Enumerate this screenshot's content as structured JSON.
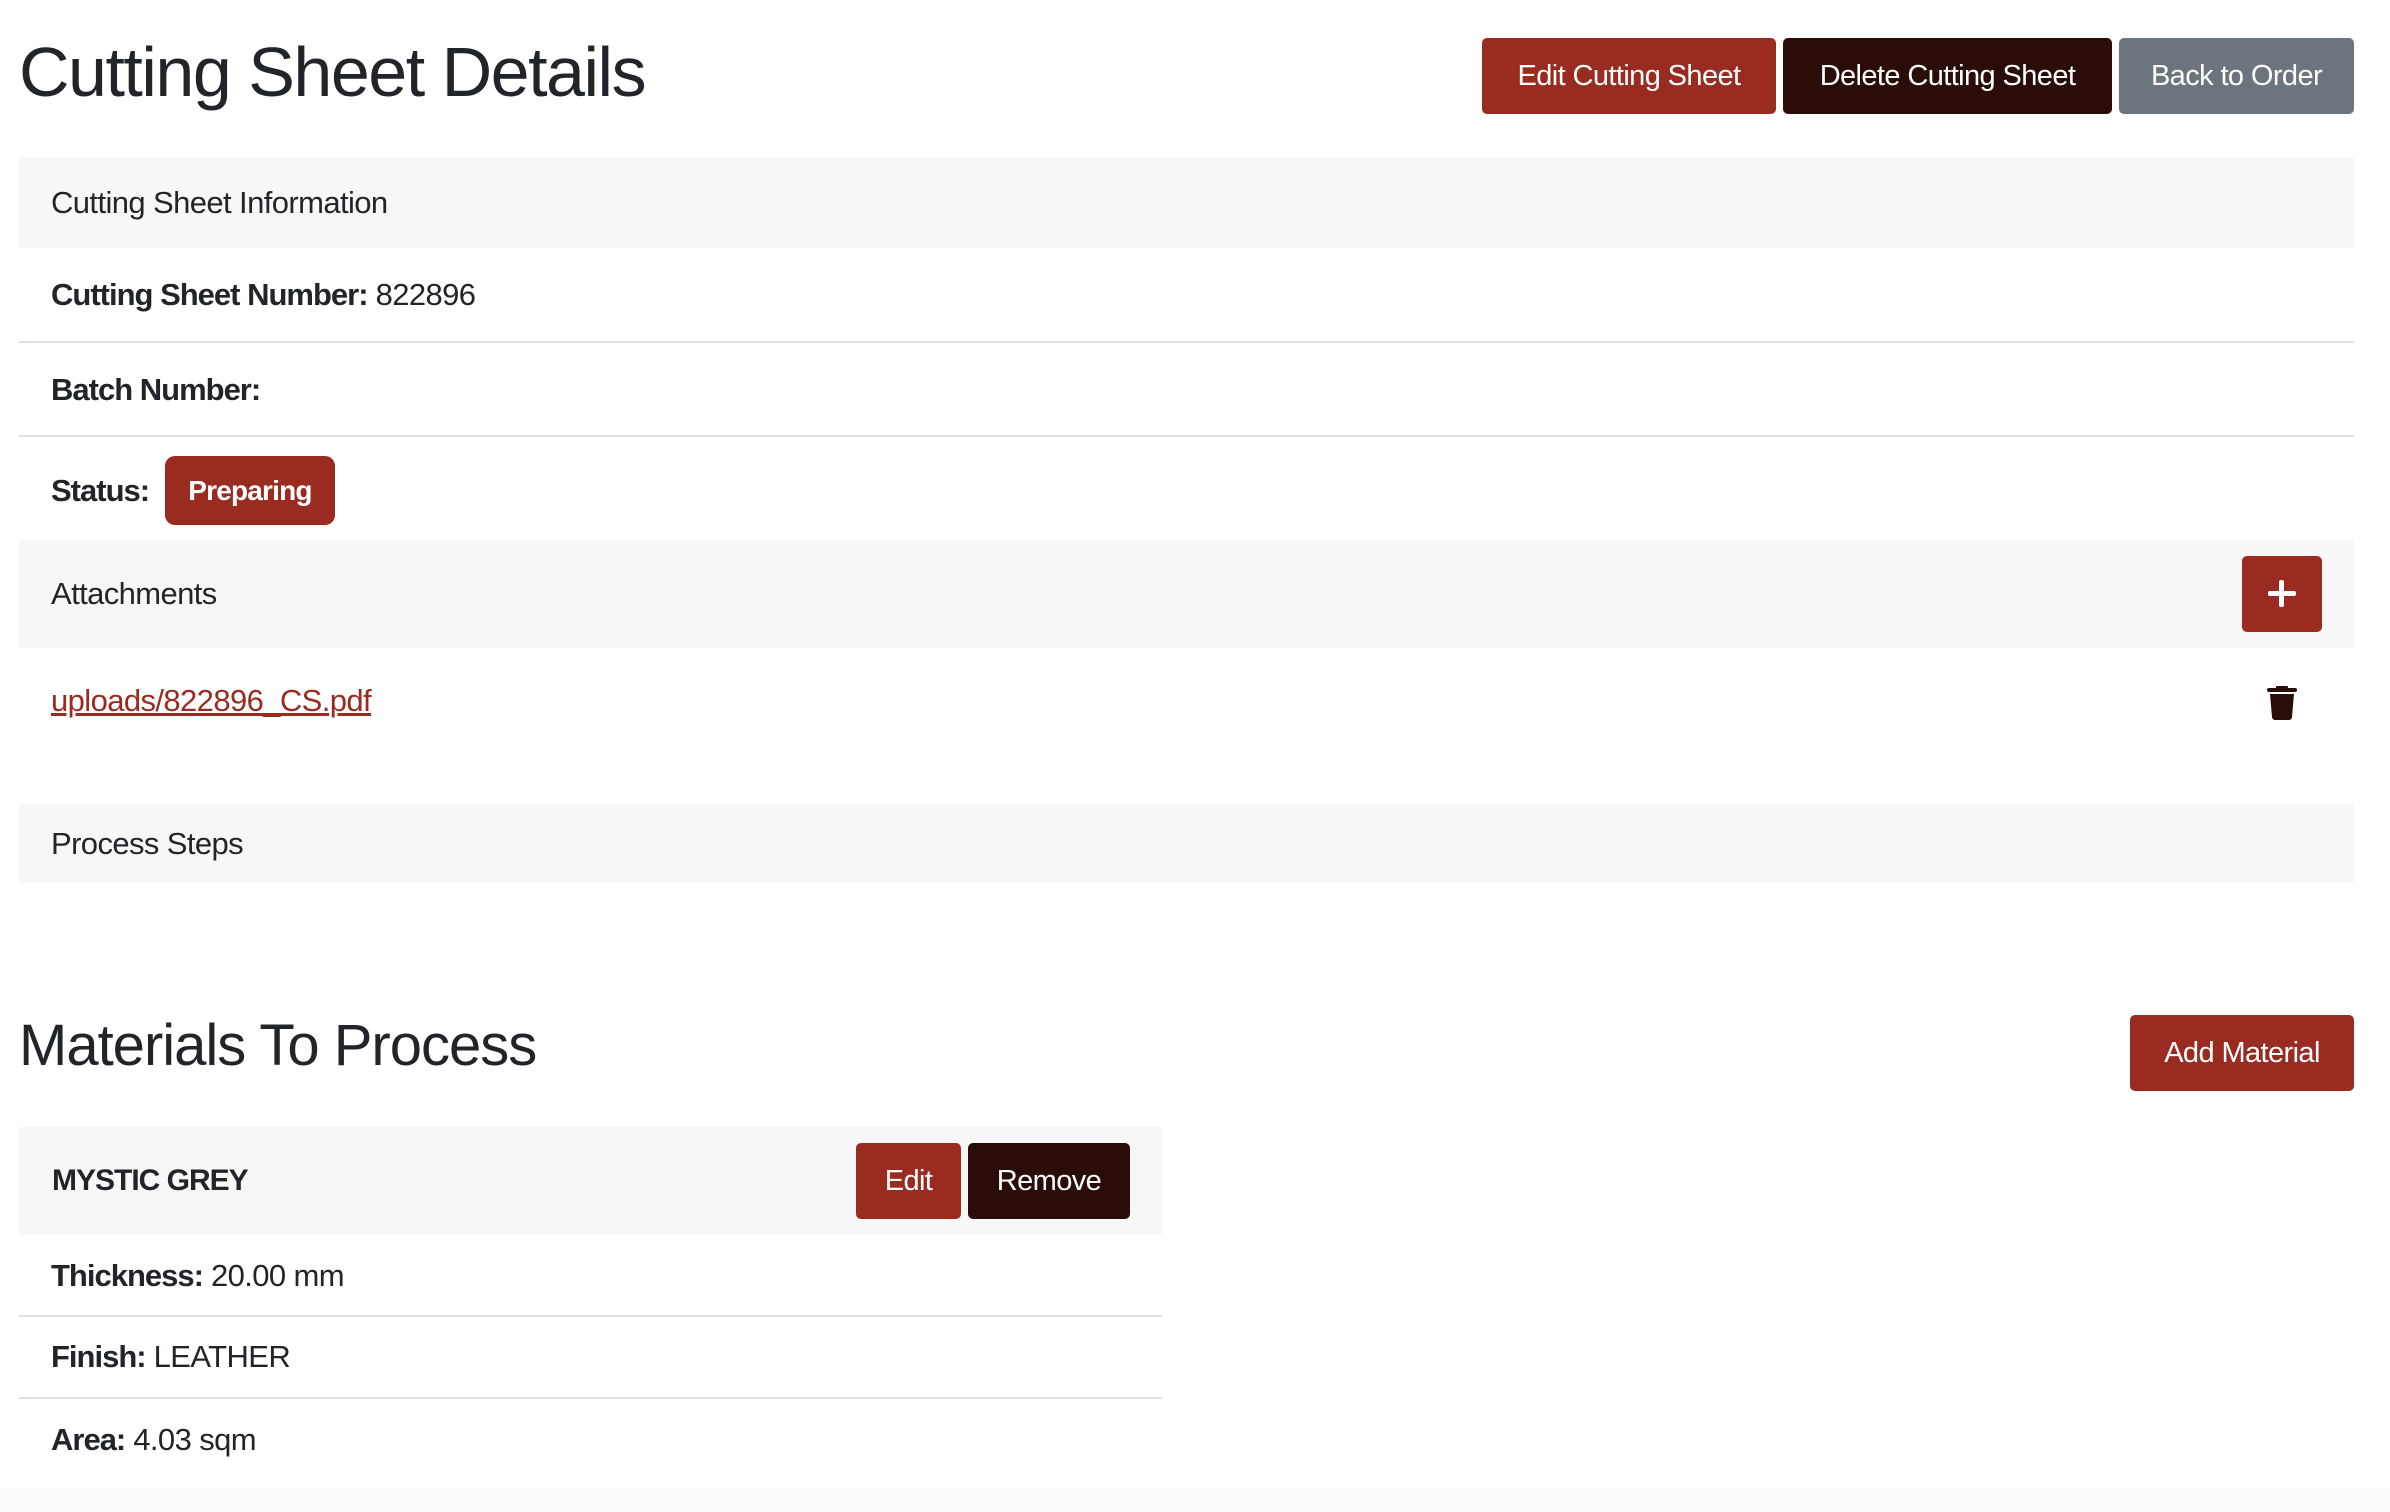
{
  "header": {
    "title": "Cutting Sheet Details",
    "buttons": {
      "edit": "Edit Cutting Sheet",
      "delete": "Delete Cutting Sheet",
      "back": "Back to Order"
    }
  },
  "info_card": {
    "title": "Cutting Sheet Information",
    "fields": [
      {
        "label": "Cutting Sheet Number:",
        "value": "822896"
      },
      {
        "label": "Batch Number:",
        "value": ""
      },
      {
        "label": "Status:",
        "value": "Preparing"
      }
    ],
    "status_color": "#992b20"
  },
  "attachments_card": {
    "title": "Attachments",
    "add_icon": "plus-icon",
    "items": [
      {
        "filename": "uploads/822896_CS.pdf",
        "delete_icon": "trash-icon"
      }
    ]
  },
  "process_steps_card": {
    "title": "Process Steps"
  },
  "materials": {
    "title": "Materials To Process",
    "add_button": "Add Material",
    "items": [
      {
        "name": "MYSTIC GREY",
        "edit_button": "Edit",
        "remove_button": "Remove",
        "fields": [
          {
            "label": "Thickness:",
            "value": "20.00 mm"
          },
          {
            "label": "Finish:",
            "value": "LEATHER"
          },
          {
            "label": "Area:",
            "value": "4.03 sqm"
          }
        ]
      }
    ]
  },
  "colors": {
    "primary": "#992b20",
    "dark": "#2a0d08",
    "secondary": "#6c757d",
    "card_header_bg": "#f7f7f7",
    "divider": "#dee2e6"
  }
}
